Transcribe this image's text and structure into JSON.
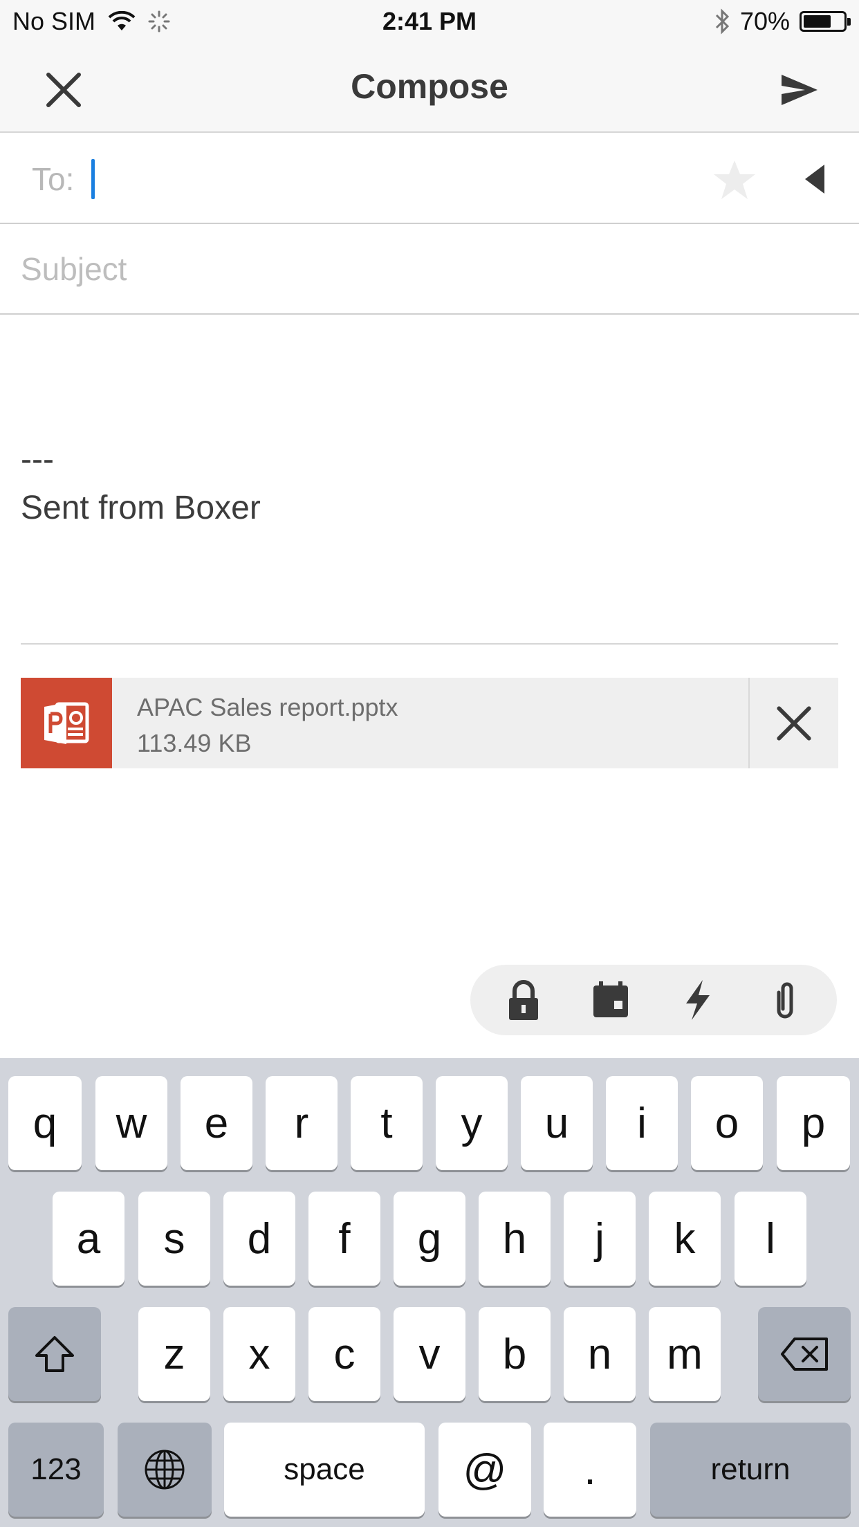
{
  "status_bar": {
    "carrier": "No SIM",
    "time": "2:41 PM",
    "battery_percent": "70%",
    "battery_level": 0.7
  },
  "nav": {
    "title": "Compose",
    "close_icon": "close-icon",
    "send_icon": "send-icon"
  },
  "compose": {
    "to_label": "To:",
    "subject_placeholder": "Subject",
    "signature_separator": "---",
    "signature": "Sent from Boxer"
  },
  "attachment": {
    "file_name": "APAC Sales report.pptx",
    "file_size": "113.49 KB",
    "icon": "powerpoint-icon",
    "color": "#cf4a33"
  },
  "toolbar": {
    "icons": [
      "lock-icon",
      "calendar-icon",
      "lightning-icon",
      "paperclip-icon"
    ]
  },
  "keyboard": {
    "row1": [
      "q",
      "w",
      "e",
      "r",
      "t",
      "y",
      "u",
      "i",
      "o",
      "p"
    ],
    "row2": [
      "a",
      "s",
      "d",
      "f",
      "g",
      "h",
      "j",
      "k",
      "l"
    ],
    "row3": [
      "z",
      "x",
      "c",
      "v",
      "b",
      "n",
      "m"
    ],
    "numbers": "123",
    "space": "space",
    "at": "@",
    "period": ".",
    "return": "return"
  },
  "colors": {
    "caret": "#1a7fe0",
    "keyboard_bg": "#d1d4db"
  }
}
